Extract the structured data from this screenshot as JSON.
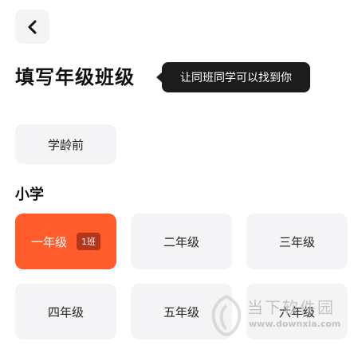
{
  "header": {
    "back_icon": "chevron-left-icon",
    "title": "填写年级班级",
    "tooltip": "让同班同学可以找到你"
  },
  "preschool": {
    "label": "学龄前"
  },
  "primary": {
    "section_title": "小学",
    "grades": [
      {
        "label": "一年级",
        "badge": "1班",
        "selected": true
      },
      {
        "label": "二年级",
        "selected": false
      },
      {
        "label": "三年级",
        "selected": false
      },
      {
        "label": "四年级",
        "selected": false
      },
      {
        "label": "五年级",
        "selected": false
      },
      {
        "label": "六年级",
        "selected": false
      }
    ]
  },
  "watermark": {
    "text": "当下软件园",
    "url": "www.downxia.com"
  },
  "colors": {
    "accent": "#ff5b2b",
    "badge": "#b5361a",
    "chip_bg": "#f4f4f6",
    "tooltip_bg": "#1c1c1c"
  }
}
